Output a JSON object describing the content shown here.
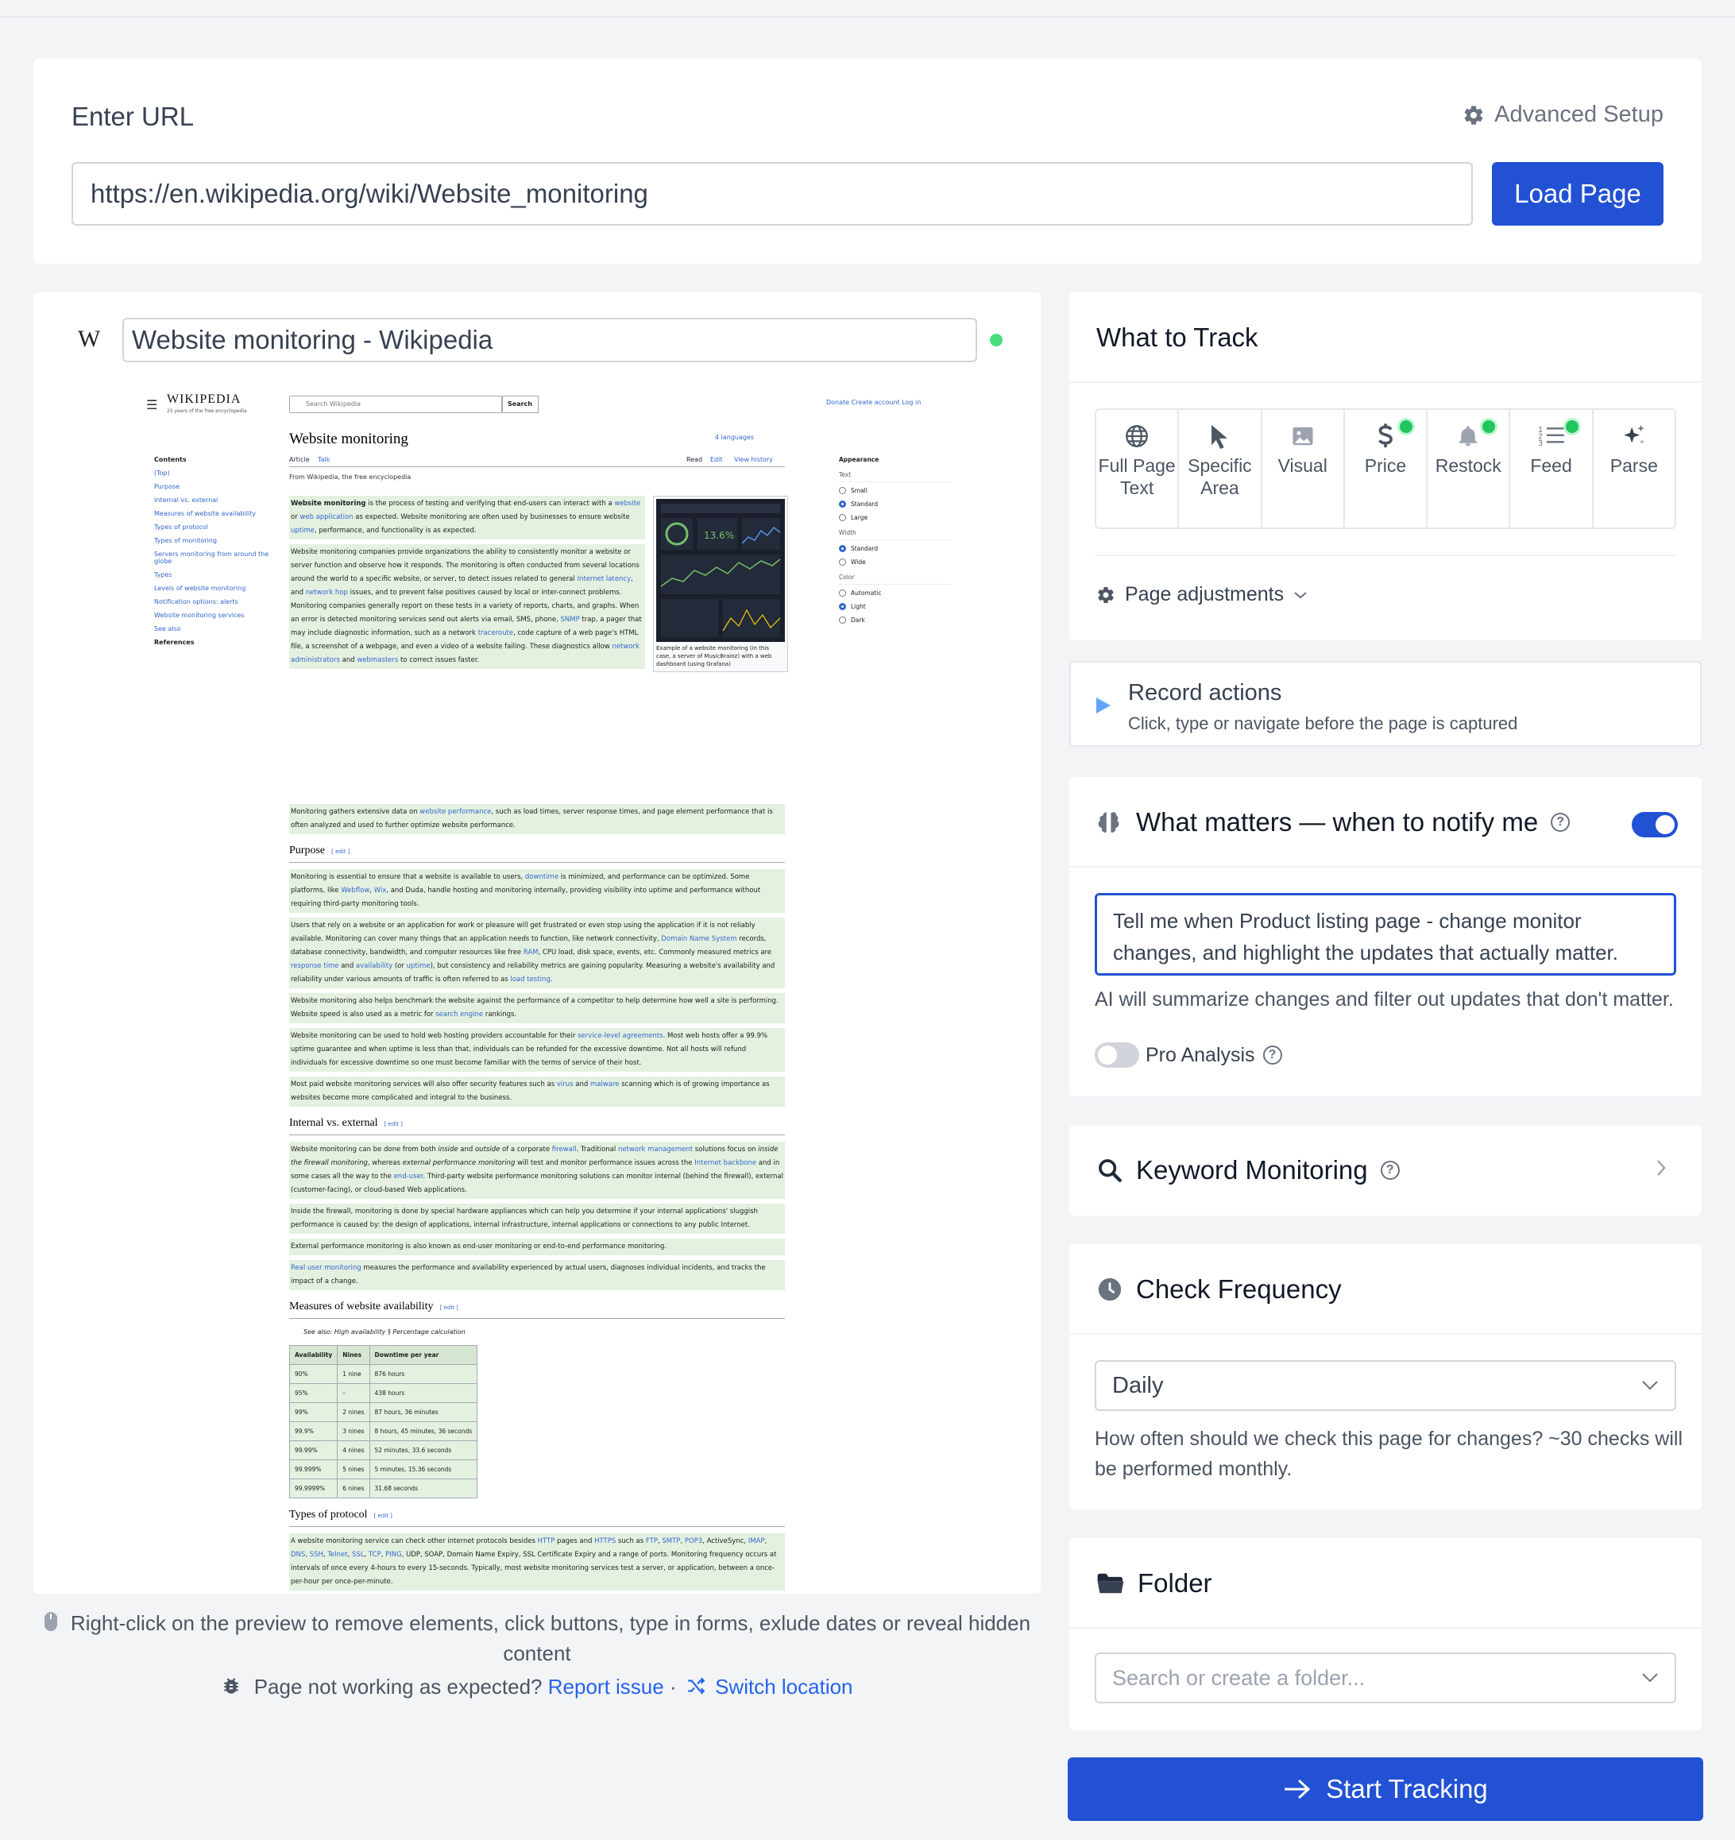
{
  "url_section": {
    "title": "Enter URL",
    "advanced_setup": "Advanced Setup",
    "url_value": "https://en.wikipedia.org/wiki/Website_monitoring",
    "load_button": "Load Page"
  },
  "preview": {
    "page_title": "Website monitoring - Wikipedia",
    "wiki": {
      "logo": "WIKIPEDIA",
      "logo_sub": "25 years of the free encyclopedia",
      "search_placeholder": "Search Wikipedia",
      "search_button": "Search",
      "top_links": "Donate  Create account  Log in",
      "heading": "Website monitoring",
      "languages": "4 languages",
      "tab_article": "Article",
      "tab_talk": "Talk",
      "tab_read": "Read",
      "tab_edit": "Edit",
      "tab_history": "View history",
      "from": "From Wikipedia, the free encyclopedia",
      "contents": [
        "Contents",
        "(Top)",
        "Purpose",
        "Internal vs. external",
        "Measures of website availability",
        "Types of protocol",
        "Types of monitoring",
        "Servers monitoring from around the globe",
        "Types",
        "Levels of website monitoring",
        "Notification options: alerts",
        "Website monitoring services",
        "See also",
        "References"
      ],
      "appearance": {
        "title": "Appearance",
        "text_label": "Text",
        "text_opts": [
          "Small",
          "Standard",
          "Large"
        ],
        "width_label": "Width",
        "width_opts": [
          "Standard",
          "Wide"
        ],
        "color_label": "Color",
        "color_opts": [
          "Automatic",
          "Light",
          "Dark"
        ]
      },
      "figure_caption": "Example of a website monitoring (in this case, a server of MusicBrainz) with a web dashboard (using Grafana)",
      "sections": {
        "purpose": "Purpose",
        "internal": "Internal vs. external",
        "measures": "Measures of website availability",
        "protocol": "Types of protocol"
      },
      "see_also": "See also: High availability § Percentage calculation",
      "table": {
        "headers": [
          "Availability",
          "Nines",
          "Downtime per year"
        ],
        "rows": [
          [
            "90%",
            "1 nine",
            "876 hours"
          ],
          [
            "95%",
            "–",
            "438 hours"
          ],
          [
            "99%",
            "2 nines",
            "87 hours, 36 minutes"
          ],
          [
            "99.9%",
            "3 nines",
            "8 hours, 45 minutes, 36 seconds"
          ],
          [
            "99.99%",
            "4 nines",
            "52 minutes, 33.6 seconds"
          ],
          [
            "99.999%",
            "5 nines",
            "5 minutes, 15.36 seconds"
          ],
          [
            "99.9999%",
            "6 nines",
            "31.68 seconds"
          ]
        ]
      }
    },
    "hint": "Right-click on the preview to remove elements, click buttons, type in forms, exlude dates or reveal hidden content",
    "issue_text": "Page not working as expected?",
    "report_issue": "Report issue",
    "separator": "·",
    "switch_location": "Switch location"
  },
  "track": {
    "title": "What to Track",
    "options": [
      {
        "label": "Full Page Text",
        "icon": "globe-icon",
        "active": false
      },
      {
        "label": "Specific Area",
        "icon": "cursor-icon",
        "active": false
      },
      {
        "label": "Visual",
        "icon": "image-icon",
        "active": false
      },
      {
        "label": "Price",
        "icon": "dollar-icon",
        "active": true
      },
      {
        "label": "Restock",
        "icon": "bell-icon",
        "active": true
      },
      {
        "label": "Feed",
        "icon": "list-icon",
        "active": true
      },
      {
        "label": "Parse",
        "icon": "sparkle-icon",
        "active": false
      }
    ],
    "adjustments": "Page adjustments"
  },
  "record": {
    "title": "Record actions",
    "subtitle": "Click, type or navigate before the page is captured"
  },
  "matters": {
    "title": "What matters — when to notify me",
    "enabled": true,
    "prompt": "Tell me when Product listing page - change monitor changes, and highlight the updates that actually matter.",
    "note": "AI will summarize changes and filter out updates that don't matter.",
    "pro_label": "Pro Analysis",
    "pro_enabled": false
  },
  "keyword": {
    "title": "Keyword Monitoring"
  },
  "frequency": {
    "title": "Check Frequency",
    "value": "Daily",
    "note": "How often should we check this page for changes? ~30 checks will be performed monthly."
  },
  "folder": {
    "title": "Folder",
    "placeholder": "Search or create a folder..."
  },
  "start_button": "Start Tracking",
  "colors": {
    "accent": "#2251d4",
    "active_dot": "#22c55e",
    "link": "#2563eb"
  }
}
